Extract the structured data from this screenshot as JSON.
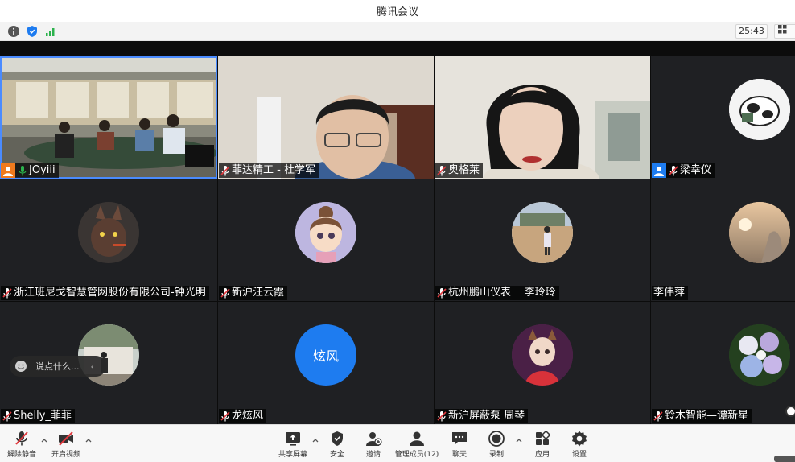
{
  "window": {
    "title": "腾讯会议"
  },
  "topbar": {
    "timer": "25:43",
    "view_label": "宫"
  },
  "participants": [
    {
      "name": "JOyiii",
      "icon": "user-icon",
      "muted": false,
      "active": true
    },
    {
      "name": "菲达精工 - 杜学军",
      "muted": true
    },
    {
      "name": "奥格莱",
      "muted": true
    },
    {
      "name": "梁幸仪",
      "icon": "user-icon",
      "muted": true
    },
    {
      "name": "浙江班尼戈智慧管网股份有限公司-钟光明",
      "muted": true
    },
    {
      "name": "新沪汪云霞",
      "muted": true
    },
    {
      "name": "杭州鹏山仪表    李玲玲",
      "muted": true
    },
    {
      "name": "李伟萍",
      "muted": false
    },
    {
      "name": "Shelly_菲菲",
      "muted": true
    },
    {
      "name": "龙炫风",
      "muted": true,
      "avatar_text": "炫风",
      "avatar_color": "#1e7cf0"
    },
    {
      "name": "新沪屏蔽泵 周琴",
      "muted": true
    },
    {
      "name": "铃木智能—谭新星",
      "muted": true
    }
  ],
  "chat": {
    "placeholder": "说点什么..."
  },
  "toolbar": {
    "unmute": "解除静音",
    "start_video": "开启视频",
    "share_screen": "共享屏幕",
    "security": "安全",
    "invite": "邀请",
    "manage_members": "管理成员(12)",
    "chat": "聊天",
    "record": "录制",
    "apps": "应用",
    "settings": "设置"
  },
  "colors": {
    "accent": "#1e7cf0",
    "muted_red": "#e0393e",
    "tile_bg": "#1f2023"
  }
}
